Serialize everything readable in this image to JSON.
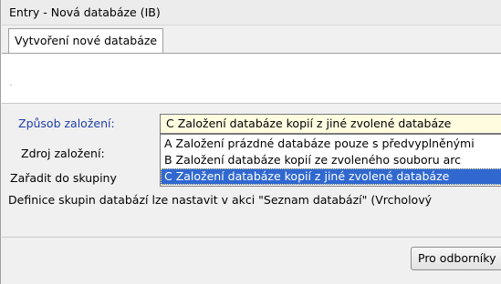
{
  "window": {
    "title": "Entry - Nová databáze (IB)"
  },
  "tabs": [
    {
      "label": "Vytvoření nové databáze"
    }
  ],
  "form": {
    "method_label": "Způsob založení:",
    "method_value": "C  Založení databáze kopií z jiné zvolené databáze",
    "source_label": "Zdroj založení:",
    "group_label": "Zařadit do skupiny",
    "info_text": "Definice skupin databází lze nastavit v akci \"Seznam databází\" (Vrcholový",
    "options": [
      "A  Založení prázdné databáze pouze s předvyplněnými",
      "B  Založení databáze kopií ze zvoleného souboru arc",
      "C  Založení databáze kopií z jiné zvolené databáze"
    ],
    "selected_option": "C"
  },
  "buttons": {
    "expert_label": "Pro odborníky"
  },
  "colors": {
    "label_blue": "#1e3ea8",
    "selection": "#3068d0",
    "combo_bg": "#fffce0"
  }
}
